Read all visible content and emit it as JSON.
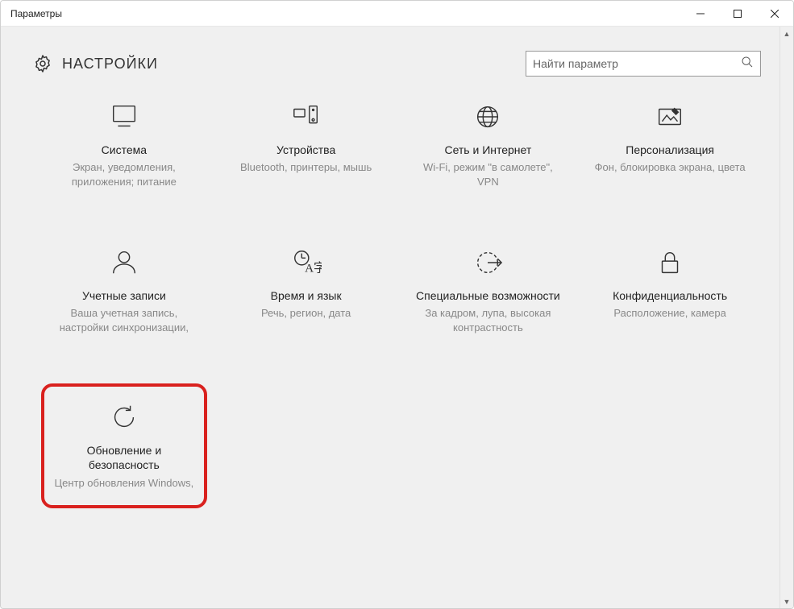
{
  "window": {
    "title": "Параметры"
  },
  "header": {
    "title": "НАСТРОЙКИ",
    "search_placeholder": "Найти параметр"
  },
  "tiles": [
    {
      "id": "system",
      "title": "Система",
      "desc": "Экран, уведомления, приложения; питание"
    },
    {
      "id": "devices",
      "title": "Устройства",
      "desc": "Bluetooth, принтеры, мышь"
    },
    {
      "id": "network",
      "title": "Сеть и Интернет",
      "desc": "Wi-Fi, режим \"в самолете\", VPN"
    },
    {
      "id": "personalization",
      "title": "Персонализация",
      "desc": "Фон, блокировка экрана, цвета"
    },
    {
      "id": "accounts",
      "title": "Учетные записи",
      "desc": "Ваша учетная запись, настройки синхронизации,"
    },
    {
      "id": "time",
      "title": "Время и язык",
      "desc": "Речь, регион, дата"
    },
    {
      "id": "ease",
      "title": "Специальные возможности",
      "desc": "За кадром, лупа, высокая контрастность"
    },
    {
      "id": "privacy",
      "title": "Конфиденциальность",
      "desc": "Расположение, камера"
    },
    {
      "id": "update",
      "title": "Обновление и безопасность",
      "desc": "Центр обновления Windows,",
      "highlight": true
    }
  ]
}
